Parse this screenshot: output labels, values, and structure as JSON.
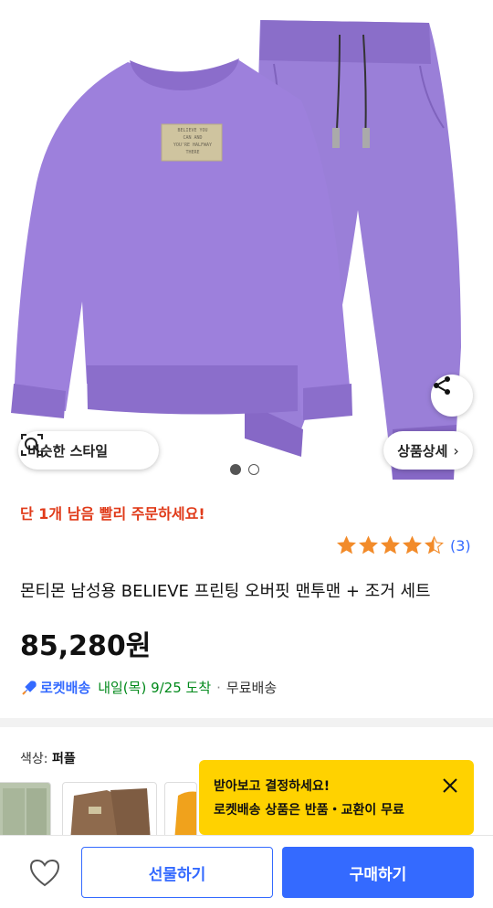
{
  "hero": {
    "print_text": [
      "BELIEVE YOU",
      "CAN AND",
      "YOU'RE HALFWAY",
      "THERE"
    ],
    "similar_style_label": "비슷한 스타일",
    "detail_label": "상품상세",
    "share_icon": "share-icon",
    "total_images": 2,
    "current_image": 1
  },
  "urgent_text": "단 1개 남음 빨리 주문하세요!",
  "rating": {
    "stars": 4.5,
    "count_text": "(3)"
  },
  "product": {
    "title": "몬티몬 남성용 BELIEVE 프린팅 오버핏 맨투맨 + 조거 세트",
    "price": "85,280원"
  },
  "delivery": {
    "badge": "로켓배송",
    "arrival": "내일(목) 9/25 도착",
    "separator": "·",
    "shipping": "무료배송"
  },
  "option": {
    "label": "색상:",
    "value": "퍼플"
  },
  "tooltip": {
    "line1": "받아보고 결정하세요!",
    "line2": "로켓배송 상품은 반품・교환이 무료"
  },
  "actions": {
    "gift": "선물하기",
    "buy": "구매하기"
  },
  "colors": {
    "accent": "#346aff",
    "urgent": "#e03a19",
    "arrival": "#00891a",
    "tooltip": "#ffd200",
    "star": "#f28b2a",
    "garment": "#9b7fd6"
  }
}
